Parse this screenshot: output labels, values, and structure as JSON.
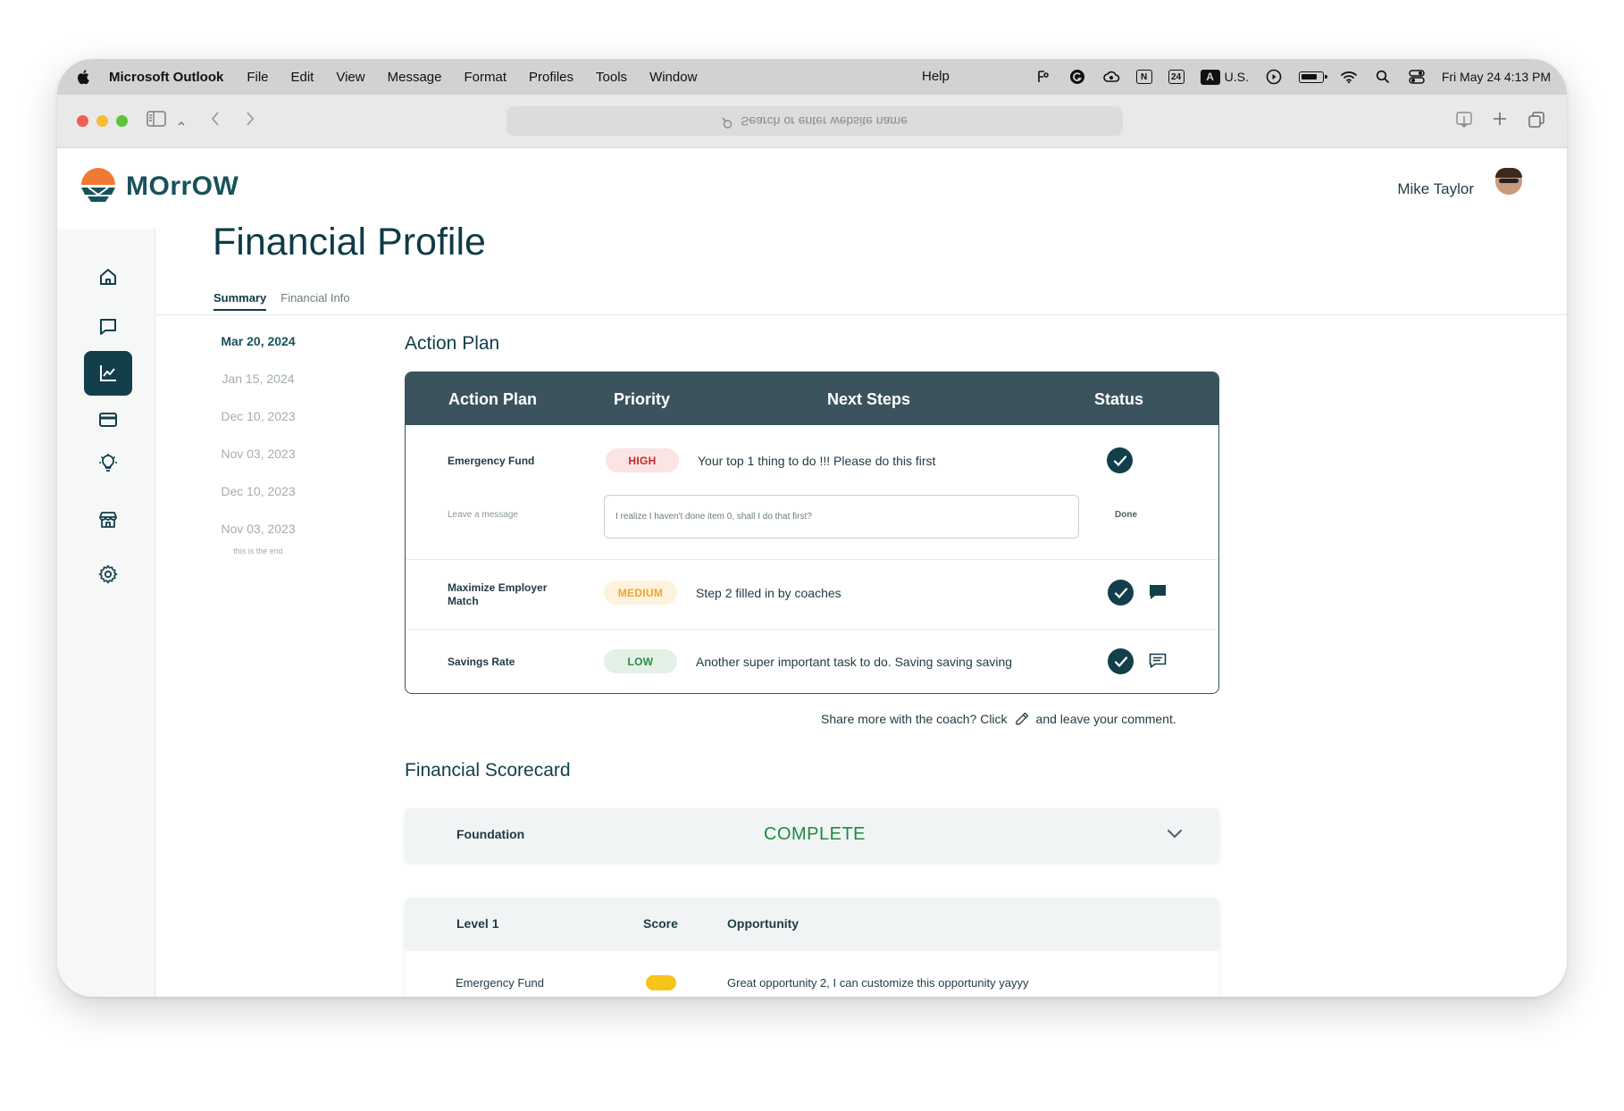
{
  "menubar": {
    "app_name": "Microsoft Outlook",
    "menus": [
      "File",
      "Edit",
      "View",
      "Message",
      "Format",
      "Profiles",
      "Tools",
      "Window"
    ],
    "help": "Help",
    "input_source": "U.S.",
    "calendar_badge": "24",
    "notion_badge": "N",
    "font_badge": "A",
    "clock": "Fri May 24  4:13 PM"
  },
  "browser": {
    "url_placeholder": "Search or enter website name"
  },
  "app": {
    "logo_text": "MOrrOW",
    "user_name": "Mike Taylor",
    "page_title": "Financial Profile",
    "tabs": [
      {
        "label": "Summary",
        "active": true
      },
      {
        "label": "Financial Info",
        "active": false
      }
    ],
    "dates": [
      "Mar 20, 2024",
      "Jan 15, 2024",
      "Dec 10, 2023",
      "Nov 03, 2023",
      "Dec 10, 2023",
      "Nov 03, 2023"
    ],
    "dates_end_note": "this is the end",
    "nav_icons": [
      "home-icon",
      "chat-icon",
      "chart-icon",
      "card-icon",
      "lightbulb-icon",
      "store-icon",
      "gear-icon"
    ]
  },
  "action_plan": {
    "section_title": "Action Plan",
    "headers": {
      "action_plan": "Action Plan",
      "priority": "Priority",
      "next_steps": "Next Steps",
      "status": "Status"
    },
    "rows": [
      {
        "name": "Emergency Fund",
        "priority": "HIGH",
        "step": "Your top 1 thing to do !!! Please do this first",
        "done": true
      },
      {
        "name": "Maximize Employer Match",
        "priority": "MEDIUM",
        "step": "Step 2 filled in by coaches",
        "done": true
      },
      {
        "name": "Savings Rate",
        "priority": "LOW",
        "step": "Another super important task to do. Saving saving saving",
        "done": true
      }
    ],
    "message": {
      "label": "Leave a message",
      "input_value": "I realize I haven't done item 0, shall I do that first?",
      "done_label": "Done"
    },
    "share_prefix": "Share more with the coach? Click",
    "share_suffix": "and leave your comment.",
    "colors": {
      "high_bg": "#fbe4e4",
      "high_fg": "#c62828",
      "medium_bg": "#fdf3dc",
      "medium_fg": "#f0a531",
      "low_bg": "#e3f1e6",
      "low_fg": "#2e8b45"
    }
  },
  "scorecard": {
    "section_title": "Financial Scorecard",
    "foundation_label": "Foundation",
    "foundation_status": "COMPLETE",
    "level_headers": {
      "level": "Level 1",
      "score": "Score",
      "opportunity": "Opportunity"
    },
    "level_rows": [
      {
        "name": "Emergency Fund",
        "score_color": "#f5c518",
        "opportunity": "Great opportunity 2, I can customize this opportunity yayyy"
      }
    ]
  }
}
